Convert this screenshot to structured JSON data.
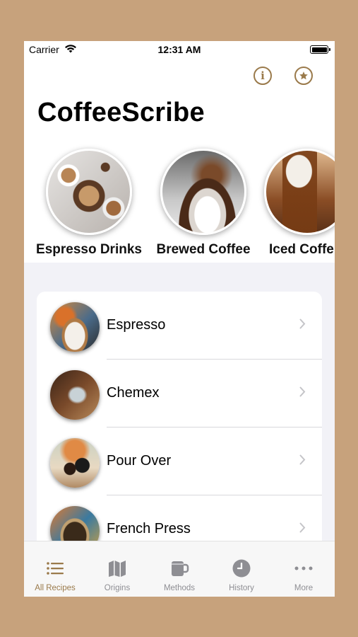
{
  "status_bar": {
    "carrier": "Carrier",
    "time": "12:31 AM"
  },
  "header": {
    "title": "CoffeeScribe",
    "info_icon": "info-icon",
    "favorites_icon": "star-icon"
  },
  "categories": [
    {
      "label": "Espresso Drinks"
    },
    {
      "label": "Brewed Coffee"
    },
    {
      "label": "Iced Coffe"
    }
  ],
  "recipes": [
    {
      "label": "Espresso"
    },
    {
      "label": "Chemex"
    },
    {
      "label": "Pour Over"
    },
    {
      "label": "French Press"
    }
  ],
  "tab_bar": {
    "tabs": [
      {
        "label": "All Recipes",
        "icon": "list-icon",
        "active": true
      },
      {
        "label": "Origins",
        "icon": "map-icon",
        "active": false
      },
      {
        "label": "Methods",
        "icon": "mug-icon",
        "active": false
      },
      {
        "label": "History",
        "icon": "clock-icon",
        "active": false
      },
      {
        "label": "More",
        "icon": "more-icon",
        "active": false
      }
    ]
  },
  "colors": {
    "accent": "#9a7a4b",
    "background_frame": "#c7a27c",
    "inactive_tab": "#8e8e93"
  }
}
